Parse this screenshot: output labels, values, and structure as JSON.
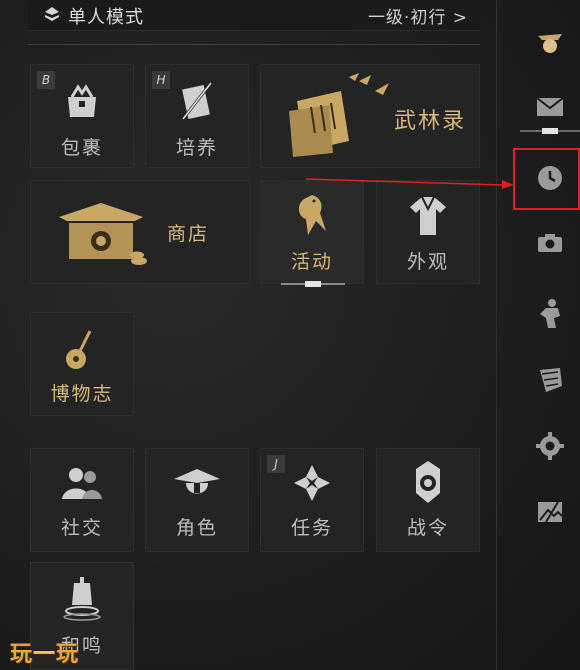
{
  "header": {
    "mode_label": "单人模式",
    "level_label": "一级·初行 >"
  },
  "tiles": {
    "bag": {
      "label": "包裹",
      "hotkey": "B"
    },
    "cultivate": {
      "label": "培养",
      "hotkey": "H"
    },
    "wulinlu": {
      "label": "武林录"
    },
    "shop": {
      "label": "商店"
    },
    "activity": {
      "label": "活动"
    },
    "appearance": {
      "label": "外观"
    },
    "museum": {
      "label": "博物志"
    },
    "social": {
      "label": "社交"
    },
    "role": {
      "label": "角色"
    },
    "quest": {
      "label": "任务",
      "hotkey": "J"
    },
    "battlepass": {
      "label": "战令"
    },
    "bottom": {
      "label": "和鸣"
    }
  },
  "sidebar": {
    "items": [
      "avatar-icon",
      "mail-icon",
      "clock-icon",
      "camera-icon",
      "action-icon",
      "fan-icon",
      "gear-icon",
      "image-icon"
    ]
  },
  "colors": {
    "gold": "#d7b77a",
    "text": "#bdbdbd",
    "highlight": "#e02020"
  },
  "watermark": {
    "part1": "玩",
    "part2": "一",
    "part3": "玩"
  }
}
